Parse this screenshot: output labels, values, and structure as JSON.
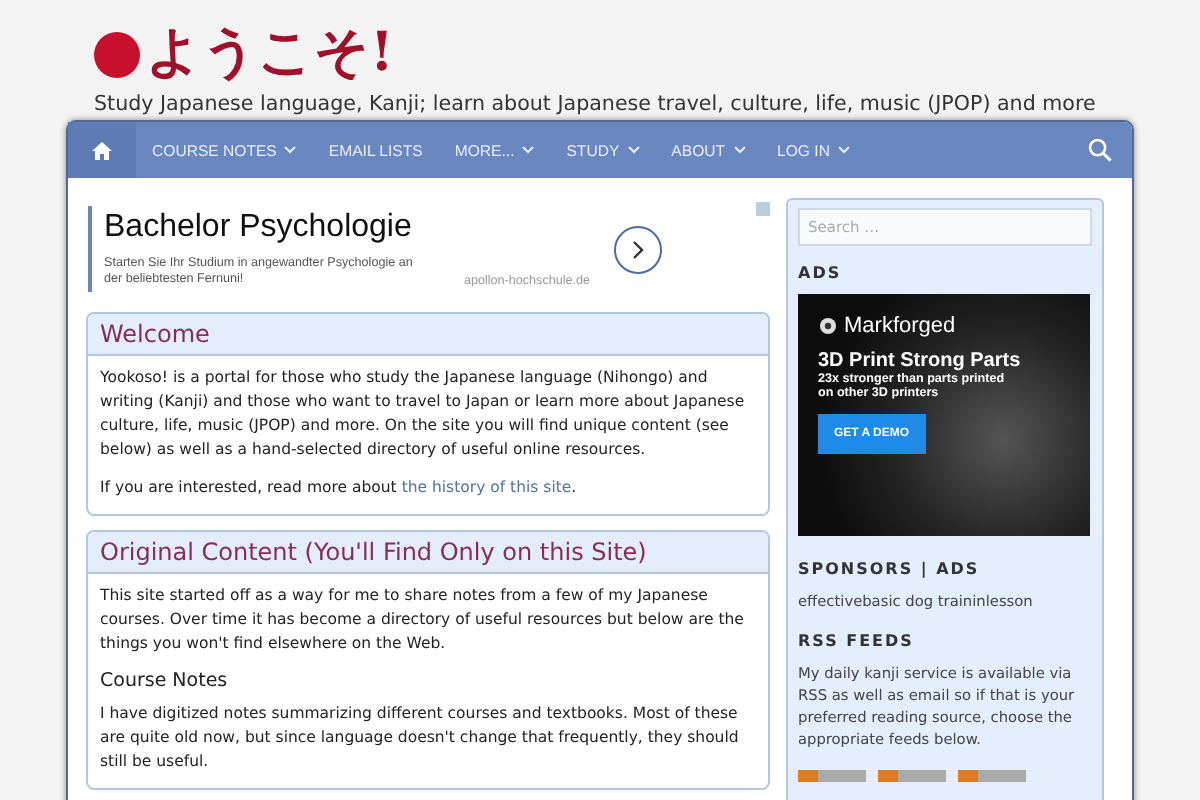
{
  "header": {
    "title": "ようこそ!",
    "tagline": "Study Japanese language, Kanji; learn about Japanese travel, culture, life, music (JPOP) and more"
  },
  "nav": {
    "items": [
      {
        "kind": "home",
        "has_menu": false,
        "selected": true
      },
      {
        "kind": "text",
        "label": "COURSE NOTES",
        "has_menu": true,
        "selected": false
      },
      {
        "kind": "text",
        "label": "EMAIL LISTS",
        "has_menu": false,
        "selected": false
      },
      {
        "kind": "text",
        "label": "MORE...",
        "has_menu": true,
        "selected": false
      },
      {
        "kind": "text",
        "label": "STUDY",
        "has_menu": true,
        "selected": false
      },
      {
        "kind": "text",
        "label": "ABOUT",
        "has_menu": true,
        "selected": false
      },
      {
        "kind": "text",
        "label": "LOG IN",
        "has_menu": true,
        "selected": false
      }
    ]
  },
  "ad": {
    "title": "Bachelor Psychologie",
    "text": "Starten Sie Ihr Studium in angewandter Psychologie an der beliebtesten Fernuni!",
    "domain": "apollon-hochschule.de"
  },
  "sections": [
    {
      "title": "Welcome",
      "blocks": [
        {
          "kind": "para",
          "text": "Yookoso! is a portal for those who study the Japanese language (Nihongo) and writing (Kanji) and those who want to travel to Japan or learn more about Japanese culture, life, music (JPOP) and more. On the site you will find unique content (see below) as well as a hand-selected directory of useful online resources."
        },
        {
          "kind": "para",
          "text": "If you are interested, read more about ",
          "link": "the history of this site",
          "after": "."
        }
      ]
    },
    {
      "title": "Original Content (You'll Find Only on this Site)",
      "blocks": [
        {
          "kind": "para",
          "text": "This site started off as a way for me to share notes from a few of my Japanese courses. Over time it has become a directory of useful resources but below are the things you won't find elsewhere on the Web."
        },
        {
          "kind": "heading",
          "text": "Course Notes"
        },
        {
          "kind": "para",
          "text": "I have digitized notes summarizing different courses and textbooks. Most of these are quite old now, but since language doesn't change that frequently, they should still be useful."
        }
      ]
    }
  ],
  "sidebar": {
    "search_placeholder": "Search …",
    "ads_title": "ADS",
    "banner": {
      "brand": "Markforged",
      "headline": "3D Print Strong Parts",
      "subline": "23x stronger than parts printed on other 3D printers",
      "button": "GET A DEMO"
    },
    "sponsors_title": "SPONSORS | ADS",
    "sponsors_text": "effectivebasic dog traininlesson",
    "rss_title": "RSS FEEDS",
    "rss_text": "My daily kanji service is available via RSS as well as email so if that is your preferred reading source, choose the appropriate feeds below."
  }
}
